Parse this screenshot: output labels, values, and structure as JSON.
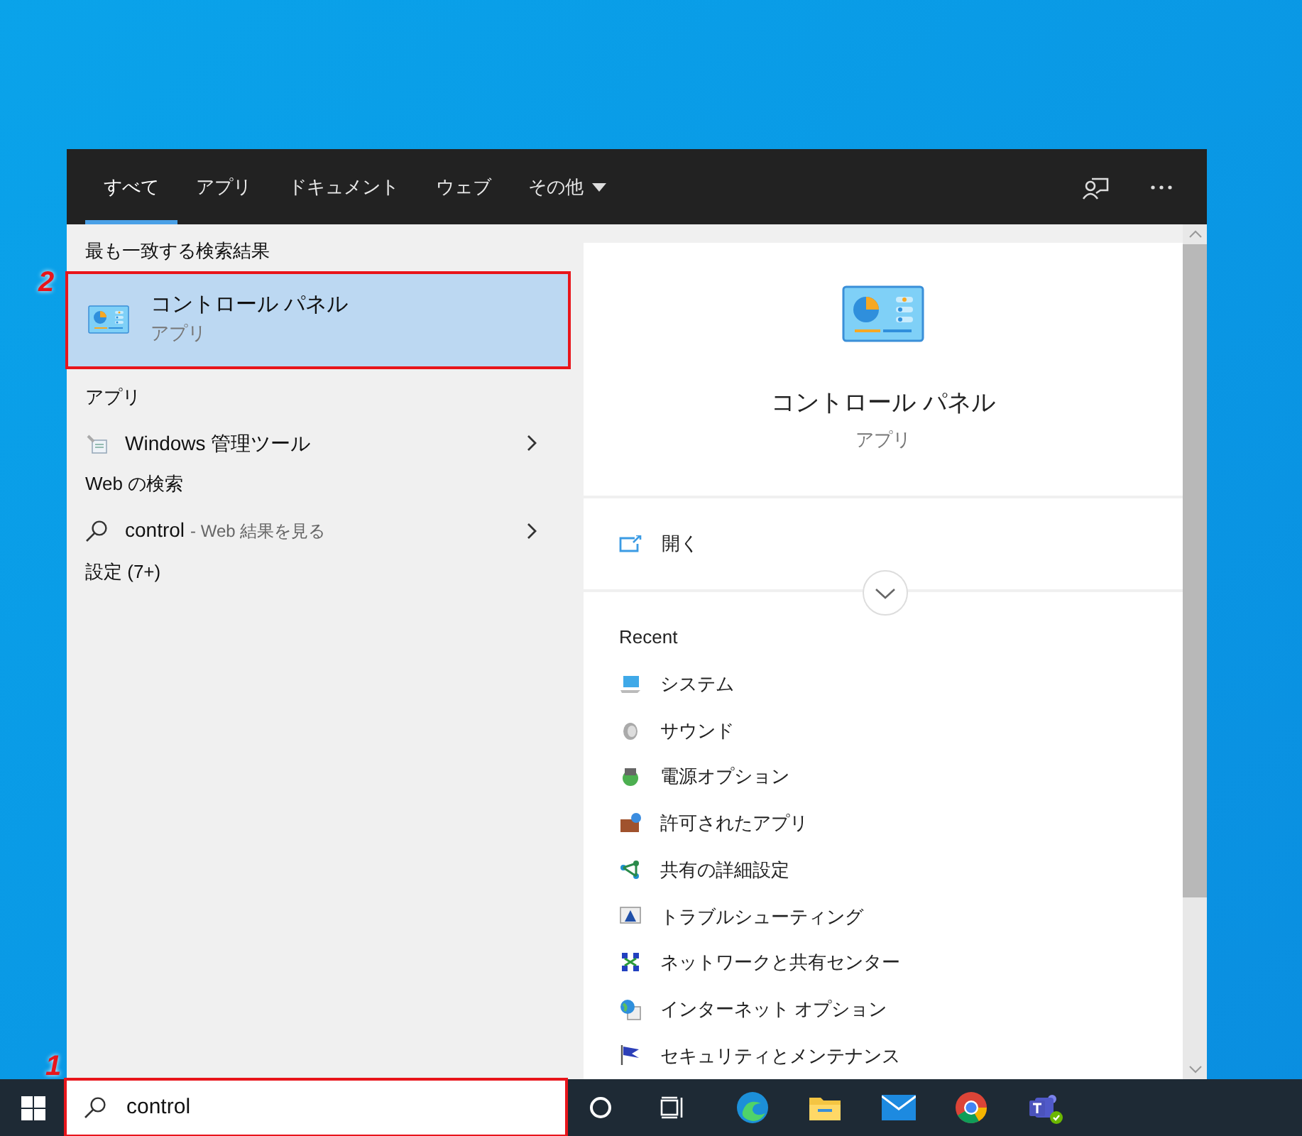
{
  "search_window": {
    "tabs": [
      {
        "label": "すべて",
        "selected": true,
        "kind": "plain"
      },
      {
        "label": "アプリ",
        "selected": false,
        "kind": "plain"
      },
      {
        "label": "ドキュメント",
        "selected": false,
        "kind": "plain"
      },
      {
        "label": "ウェブ",
        "selected": false,
        "kind": "plain"
      },
      {
        "label": "その他",
        "selected": false,
        "kind": "dropdown"
      }
    ],
    "results": {
      "best_match_heading": "最も一致する検索結果",
      "best_match": {
        "title": "コントロール パネル",
        "subtitle": "アプリ",
        "selected": true,
        "callout": "2"
      },
      "apps_heading": "アプリ",
      "apps": [
        {
          "label": "Windows 管理ツール"
        }
      ],
      "web_heading": "Web の検索",
      "web": [
        {
          "query": "control",
          "suffix": "- Web 結果を見る"
        }
      ],
      "settings_heading": "設定 (7+)"
    },
    "preview": {
      "title": "コントロール パネル",
      "subtitle": "アプリ",
      "actions": [
        {
          "label": "開く"
        }
      ],
      "recent_heading": "Recent",
      "recent": [
        {
          "label": "システム"
        },
        {
          "label": "サウンド"
        },
        {
          "label": "電源オプション"
        },
        {
          "label": "許可されたアプリ"
        },
        {
          "label": "共有の詳細設定"
        },
        {
          "label": "トラブルシューティング"
        },
        {
          "label": "ネットワークと共有センター"
        },
        {
          "label": "インターネット オプション"
        },
        {
          "label": "セキュリティとメンテナンス"
        }
      ]
    }
  },
  "taskbar": {
    "search_box": {
      "value": "control",
      "callout": "1"
    }
  }
}
